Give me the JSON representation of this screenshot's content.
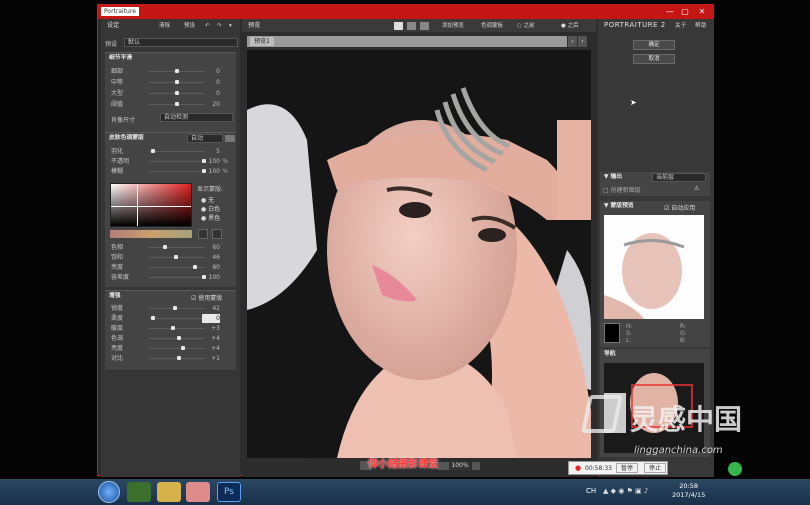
{
  "window": {
    "app_logo": "Portraiture",
    "sys": [
      "—",
      "▢",
      "✕"
    ]
  },
  "left": {
    "title": "设定",
    "reset": "清除",
    "preset": "预设",
    "preset_row": {
      "label": "预设",
      "value": "默认"
    },
    "detail": {
      "title": "细节平滑",
      "rows": [
        {
          "label": "细部",
          "value": "0"
        },
        {
          "label": "中等",
          "value": "0"
        },
        {
          "label": "大型",
          "value": "0"
        },
        {
          "label": "阈值",
          "value": "20"
        }
      ],
      "size_label": "肖像尺寸",
      "size_value": "自动检测"
    },
    "mask": {
      "title": "皮肤色调蒙版",
      "mode": "自动",
      "rows": [
        {
          "label": "羽化",
          "value": "5"
        },
        {
          "label": "不透明",
          "value": "100",
          "unit": "%"
        },
        {
          "label": "模糊",
          "value": "100",
          "unit": "%"
        }
      ],
      "display_label": "显示蒙版:",
      "options": [
        "无",
        "白色",
        "黑色"
      ],
      "rows2": [
        {
          "label": "色相",
          "value": "60"
        },
        {
          "label": "饱和",
          "value": "46"
        },
        {
          "label": "亮度",
          "value": "80"
        },
        {
          "label": "容差度",
          "value": "100"
        }
      ]
    },
    "enhance": {
      "title": "增强",
      "use_mask": "使用蒙版",
      "rows": [
        {
          "label": "锐度",
          "value": "42"
        },
        {
          "label": "柔度",
          "value": "0"
        },
        {
          "label": "暖度",
          "value": "+3"
        },
        {
          "label": "色调",
          "value": "+4"
        },
        {
          "label": "亮度",
          "value": "+4"
        },
        {
          "label": "对比",
          "value": "+1"
        }
      ]
    }
  },
  "center": {
    "title": "预览",
    "tab": "预览1",
    "add_preview": "添加预览",
    "mask_view": "色调蒙板",
    "before": "之前",
    "after": "之后",
    "zoom": "100%"
  },
  "right": {
    "brand": "PORTRAITURE",
    "version": "2",
    "about": "关于",
    "help": "帮助",
    "ok": "确定",
    "cancel": "取消",
    "output": {
      "title": "输出",
      "value": "当前层",
      "create_layer": "创建新图层"
    },
    "mask_preview": {
      "title": "蒙版预览",
      "auto": "自动应用",
      "h": "H:",
      "s": "S:",
      "l": "L:",
      "r": "R:",
      "g": "G:",
      "b": "B:"
    },
    "navigator": {
      "title": "导航"
    }
  },
  "caption": "仰小猪摄影课堂",
  "recording": {
    "time": "00:58:33",
    "pause": "暂停",
    "stop": "停止"
  },
  "watermark": {
    "brand": "灵感中国",
    "url": "lingganchina.com"
  },
  "taskbar": {
    "ch": "CH",
    "time": "20:58",
    "date": "2017/4/15"
  }
}
